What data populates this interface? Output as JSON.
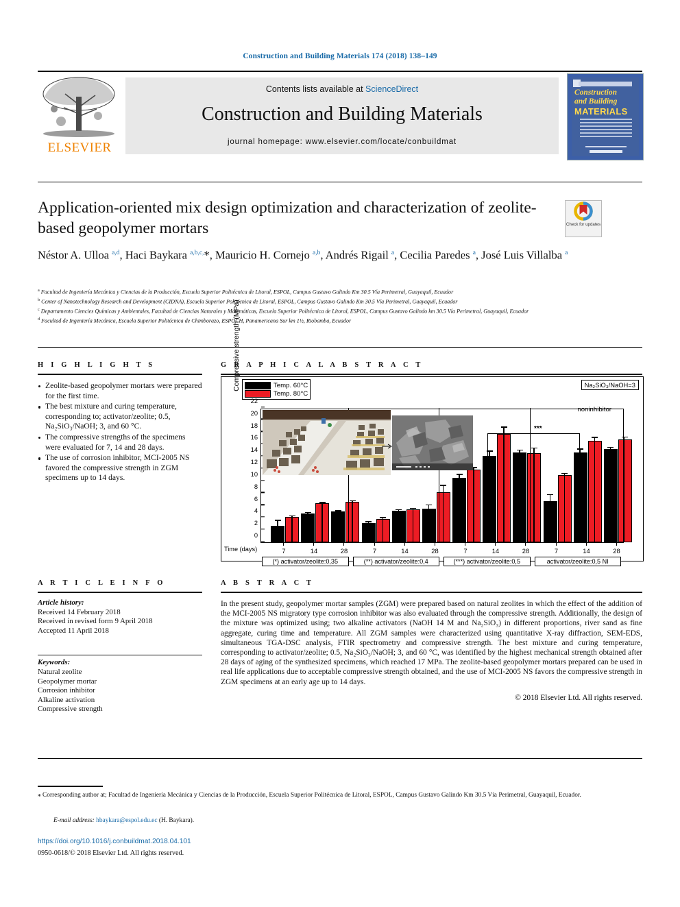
{
  "running_head": "Construction and Building Materials 174 (2018) 138–149",
  "masthead": {
    "contents_text": "Contents lists available at ",
    "sciencedirect": "ScienceDirect",
    "journal_title": "Construction and Building Materials",
    "homepage": "journal homepage: www.elsevier.com/locate/conbuildmat",
    "publisher_logo_text": "ELSEVIER",
    "cover": {
      "line1": "Construction",
      "line2": "and Building",
      "line3": "MATERIALS"
    }
  },
  "article": {
    "title": "Application-oriented mix design optimization and characterization of zeolite-based geopolymer mortars",
    "crossmark": "Check for updates",
    "authors_html": "Néstor A. Ulloa <sup>a,d</sup>, Haci Baykara <sup>a,b,c,</sup>*, Mauricio H. Cornejo <sup>a,b</sup>, Andrés Rigail <sup>a</sup>, Cecilia Paredes <sup>a</sup>, José Luis Villalba <sup>a</sup>",
    "affiliations": [
      "Facultad de Ingeniería Mecánica y Ciencias de la Producción, Escuela Superior Politécnica de Litoral, ESPOL, Campus Gustavo Galindo Km 30.5 Vía Perimetral, Guayaquil, Ecuador",
      "Center of Nanotechnology Research and Development (CIDNA), Escuela Superior Politécnica de Litoral, ESPOL, Campus Gustavo Galindo Km 30.5 Vía Perimetral, Guayaquil, Ecuador",
      "Departamento Ciencies Químicas y Ambientales, Facultad de Ciencias Naturales y Matemáticas, Escuela Superior Politécnica de Litoral, ESPOL, Campus Gustavo Galindo km 30.5 Vía Perimetral, Guayaquil, Ecuador",
      "Facultad de Ingeniería Mecánica, Escuela Superior Politécnica de Chimborazo, ESPOCH, Panamericana Sur km 1½, Riobamba, Ecuador"
    ],
    "affiliation_marks": [
      "a",
      "b",
      "c",
      "d"
    ]
  },
  "highlights": {
    "heading": "H I G H L I G H T S",
    "items": [
      "Zeolite-based geopolymer mortars were prepared for the first time.",
      "The best mixture and curing temperature, corresponding to; activator/zeolite; 0.5, Na₂SiO₃/NaOH; 3, and 60 °C.",
      "The compressive strengths of the specimens were evaluated for 7, 14 and 28 days.",
      "The use of corrosion inhibitor, MCI-2005 NS favored the compressive strength in ZGM specimens up to 14 days."
    ]
  },
  "graphical_abstract": {
    "heading": "G R A P H I C A L   A B S T R A C T"
  },
  "article_info": {
    "heading": "A R T I C L E   I N F O",
    "history_label": "Article history:",
    "history": [
      "Received 14 February 2018",
      "Received in revised form 9 April 2018",
      "Accepted 11 April 2018"
    ],
    "keywords_label": "Keywords:",
    "keywords": [
      "Natural zeolite",
      "Geopolymer mortar",
      "Corrosion inhibitor",
      "Alkaline activation",
      "Compressive strength"
    ]
  },
  "abstract": {
    "heading": "A B S T R A C T",
    "body": "In the present study, geopolymer mortar samples (ZGM) were prepared based on natural zeolites in which the effect of the addition of the MCI-2005 NS migratory type corrosion inhibitor was also evaluated through the compressive strength. Additionally, the design of the mixture was optimized using; two alkaline activators (NaOH 14 M and Na₂SiO₃) in different proportions, river sand as fine aggregate, curing time and temperature. All ZGM samples were characterized using quantitative X-ray diffraction, SEM-EDS, simultaneous TGA-DSC analysis, FTIR spectrometry and compressive strength. The best mixture and curing temperature, corresponding to activator/zeolite; 0.5, Na₂SiO₃/NaOH; 3, and 60 °C, was identified by the highest mechanical strength obtained after 28 days of aging of the synthesized specimens, which reached 17 MPa. The zeolite-based geopolymer mortars prepared can be used in real life applications due to acceptable compressive strength obtained, and the use of MCI-2005 NS favors the compressive strength in ZGM specimens at an early age up to 14 days.",
    "copyright": "© 2018 Elsevier Ltd. All rights reserved."
  },
  "footer": {
    "corresponding_marker": "⁎",
    "corresponding": "Corresponding author at; Facultad de Ingeniería Mecánica y Ciencias de la Producción, Escuela Superior Politécnica de Litoral, ESPOL, Campus Gustavo Galindo Km 30.5 Vía Perimetral, Guayaquil, Ecuador.",
    "email_label": "E-mail address:",
    "email": "hbaykara@espol.edu.ec",
    "email_owner": "(H. Baykara).",
    "doi": "https://doi.org/10.1016/j.conbuildmat.2018.04.101",
    "issn": "0950-0618/© 2018 Elsevier Ltd. All rights reserved."
  },
  "chart_data": {
    "type": "bar",
    "title": "",
    "xlabel": "Time (days)",
    "ylabel": "Compressive strength (MPa)",
    "ylim": [
      0,
      22
    ],
    "ytick_step": 2,
    "yticks": [
      0,
      2,
      4,
      6,
      8,
      10,
      12,
      14,
      16,
      18,
      20,
      22
    ],
    "annotation_box": "Na₂SiO₃/NaOH=3",
    "annotation_noninhibitor": "noninhibitor",
    "legend": [
      {
        "name": "Temp. 60°C",
        "color": "#000000"
      },
      {
        "name": "Temp. 80°C",
        "color": "#ed1c24"
      }
    ],
    "legend_position": "top-left",
    "grid": false,
    "groups": [
      {
        "label": "(*) activator/zeolite:0,35",
        "significance": "*",
        "categories": [
          "7",
          "14",
          "28"
        ],
        "series": [
          {
            "name": "Temp. 60°C",
            "color": "#000000",
            "values": [
              2.65,
              4.7,
              5.0
            ],
            "errors": [
              0.85,
              0.12,
              0.1
            ]
          },
          {
            "name": "Temp. 80°C",
            "color": "#ed1c24",
            "values": [
              4.1,
              6.35,
              6.65
            ],
            "errors": [
              0.12,
              0.1,
              0.08
            ]
          }
        ]
      },
      {
        "label": "(**) activator/zeolite:0,4",
        "significance": "**",
        "categories": [
          "7",
          "14",
          "28"
        ],
        "series": [
          {
            "name": "Temp. 60°C",
            "color": "#000000",
            "values": [
              3.2,
              5.15,
              5.5
            ],
            "errors": [
              0.08,
              0.1,
              0.55
            ]
          },
          {
            "name": "Temp. 80°C",
            "color": "#ed1c24",
            "values": [
              3.8,
              5.4,
              8.2
            ],
            "errors": [
              0.18,
              0.08,
              1.05
            ]
          }
        ]
      },
      {
        "label": "(***) activator/zeolite:0,5",
        "significance": "***",
        "categories": [
          "7",
          "14",
          "28"
        ],
        "series": [
          {
            "name": "Temp. 60°C",
            "color": "#000000",
            "values": [
              10.5,
              14.15,
              14.65
            ],
            "errors": [
              0.55,
              0.7,
              0.35
            ]
          },
          {
            "name": "Temp. 80°C",
            "color": "#ed1c24",
            "values": [
              11.85,
              17.7,
              14.55
            ],
            "errors": [
              0.3,
              1.1,
              0.8
            ]
          }
        ]
      },
      {
        "label": "activator/zeolite:0,5 NI",
        "significance": "",
        "categories": [
          "7",
          "14",
          "28"
        ],
        "series": [
          {
            "name": "Temp. 60°C",
            "color": "#000000",
            "values": [
              6.75,
              14.65,
              15.25
            ],
            "errors": [
              1.0,
              0.55,
              0.2
            ]
          },
          {
            "name": "Temp. 80°C",
            "color": "#ed1c24",
            "values": [
              11.05,
              16.65,
              16.8
            ],
            "errors": [
              0.15,
              0.45,
              0.35
            ]
          }
        ]
      }
    ]
  }
}
